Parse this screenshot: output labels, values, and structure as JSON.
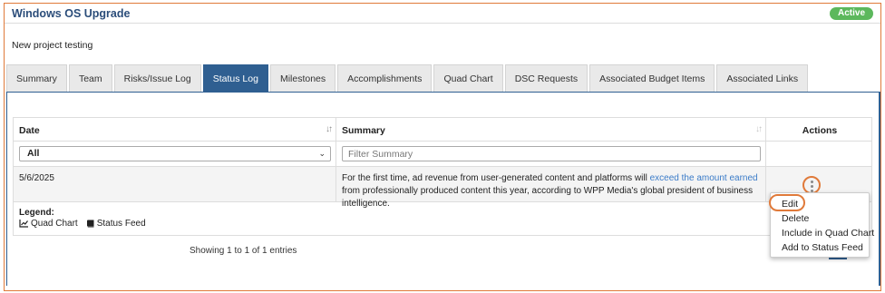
{
  "header": {
    "title": "Windows OS Upgrade",
    "status_badge": "Active"
  },
  "description": "New project testing",
  "tabs": [
    {
      "label": "Summary"
    },
    {
      "label": "Team"
    },
    {
      "label": "Risks/Issue Log"
    },
    {
      "label": "Status Log",
      "active": true
    },
    {
      "label": "Milestones"
    },
    {
      "label": "Accomplishments"
    },
    {
      "label": "Quad Chart"
    },
    {
      "label": "DSC Requests"
    },
    {
      "label": "Associated Budget Items"
    },
    {
      "label": "Associated Links"
    }
  ],
  "table": {
    "columns": {
      "date": "Date",
      "summary": "Summary",
      "actions": "Actions"
    },
    "filters": {
      "date_selected": "All",
      "summary_placeholder": "Filter Summary"
    },
    "rows": [
      {
        "date": "5/6/2025",
        "summary_before": "For the first time, ad revenue from user-generated content and platforms will ",
        "summary_link": "exceed the amount earned",
        "summary_after": " from professionally produced content this year, according to WPP Media's global president of business intelligence."
      }
    ],
    "legend": {
      "title": "Legend:",
      "items": [
        {
          "label": "Quad Chart",
          "icon": "line-chart-icon"
        },
        {
          "label": "Status Feed",
          "icon": "book-icon"
        }
      ]
    }
  },
  "pagination": {
    "info": "Showing 1 to 1 of 1 entries"
  },
  "actions_menu": {
    "items": [
      "Edit",
      "Delete",
      "Include in Quad Chart",
      "Add to Status Feed"
    ]
  },
  "colors": {
    "accent": "#2f5f91",
    "badge": "#5cb85c",
    "highlight": "#e07a3a",
    "link": "#3a7bc8"
  }
}
